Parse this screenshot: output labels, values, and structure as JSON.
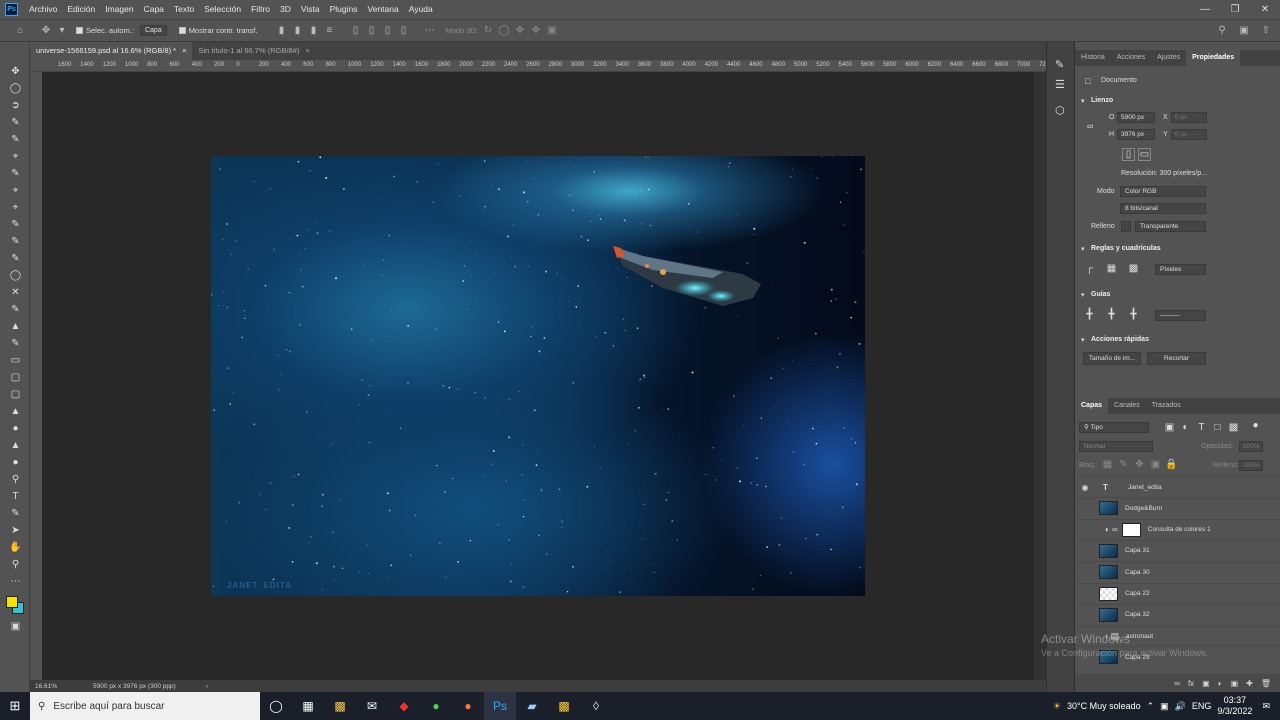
{
  "menubar": {
    "app_icon": "Ps",
    "items": [
      "Archivo",
      "Edición",
      "Imagen",
      "Capa",
      "Texto",
      "Selección",
      "Filtro",
      "3D",
      "Vista",
      "Plugins",
      "Ventana",
      "Ayuda"
    ]
  },
  "options": {
    "auto_select_label": "Selec. autom.:",
    "auto_select_target": "Capa",
    "show_transform_label": "Mostrar contr. transf.",
    "mode_3d_label": "Modo 3D:"
  },
  "doc_tabs": [
    {
      "label": "universe-1566159.psd al 16.6% (RGB/8) *",
      "close": "×"
    },
    {
      "label": "Sin título-1 al 66.7% (RGB/8#)",
      "close": "×"
    }
  ],
  "ruler_ticks": [
    "1600",
    "1400",
    "1200",
    "1000",
    "800",
    "600",
    "400",
    "200",
    "0",
    "200",
    "400",
    "600",
    "800",
    "1000",
    "1200",
    "1400",
    "1600",
    "1800",
    "2000",
    "2200",
    "2400",
    "2600",
    "2800",
    "3000",
    "3200",
    "3400",
    "3600",
    "3800",
    "4000",
    "4200",
    "4400",
    "4600",
    "4800",
    "5000",
    "5200",
    "5400",
    "5600",
    "5800",
    "6000",
    "6200",
    "6400",
    "6600",
    "6800",
    "7000",
    "7200"
  ],
  "canvas": {
    "watermark": "JANET_EDITA"
  },
  "status": {
    "zoom": "16.61%",
    "doc_size": "5900 px x 3976 px (300 ppp)",
    "arrow": "›"
  },
  "properties": {
    "tabs": [
      "Historia",
      "Acciones",
      "Ajustes",
      "Propiedades"
    ],
    "doc_label": "Documento",
    "canvas_section": "Lienzo",
    "w_label": "O",
    "w_value": "5900 px",
    "h_label": "H",
    "h_value": "3976 px",
    "x_label": "X",
    "x_value": "0 px",
    "y_label": "Y",
    "y_value": "0 px",
    "resolution": "Resolución: 300 píxeles/p...",
    "mode_label": "Modo",
    "mode_value": "Color RGB",
    "depth_value": "8 bits/canal",
    "fill_label": "Relleno",
    "fill_value": "Transparente",
    "rulers_section": "Reglas y cuadrículas",
    "units_value": "Píxeles",
    "guides_section": "Guías",
    "quick_section": "Acciones rápidas",
    "image_size_btn": "Tamaño de im...",
    "crop_btn": "Recortar"
  },
  "layers": {
    "tabs": [
      "Capas",
      "Canales",
      "Trazados"
    ],
    "filter_kind": "Tipo",
    "blend_mode": "Normal",
    "opacity_label": "Opacidad:",
    "opacity_value": "100%",
    "lock_label": "Bloq.:",
    "fill_label": "Relleno:",
    "fill_value": "100%",
    "items": [
      {
        "name": "Janet_edita",
        "visible": true,
        "kind": "text"
      },
      {
        "name": "Dodge&Burn",
        "visible": false,
        "kind": "pixel"
      },
      {
        "name": "Consulta de colores 1",
        "visible": false,
        "kind": "adjustment"
      },
      {
        "name": "Capa 31",
        "visible": false,
        "kind": "pixel"
      },
      {
        "name": "Capa 30",
        "visible": false,
        "kind": "pixel"
      },
      {
        "name": "Capa 22",
        "visible": false,
        "kind": "empty"
      },
      {
        "name": "Capa 32",
        "visible": false,
        "kind": "pixel"
      },
      {
        "name": "astronaut",
        "visible": false,
        "kind": "group"
      },
      {
        "name": "Capa 29",
        "visible": false,
        "kind": "pixel"
      }
    ]
  },
  "watermark_windows": {
    "line1": "Activar Windows",
    "line2": "Ve a Configuración para activar Windows."
  },
  "taskbar": {
    "search_placeholder": "Escribe aquí para buscar",
    "weather": "30°C  Muy soleado",
    "lang": "ENG",
    "time": "03:37",
    "date": "9/3/2022"
  },
  "colors": {
    "foreground": "#f5e400",
    "background": "#2ec3d6",
    "accent": "#31a8ff"
  }
}
